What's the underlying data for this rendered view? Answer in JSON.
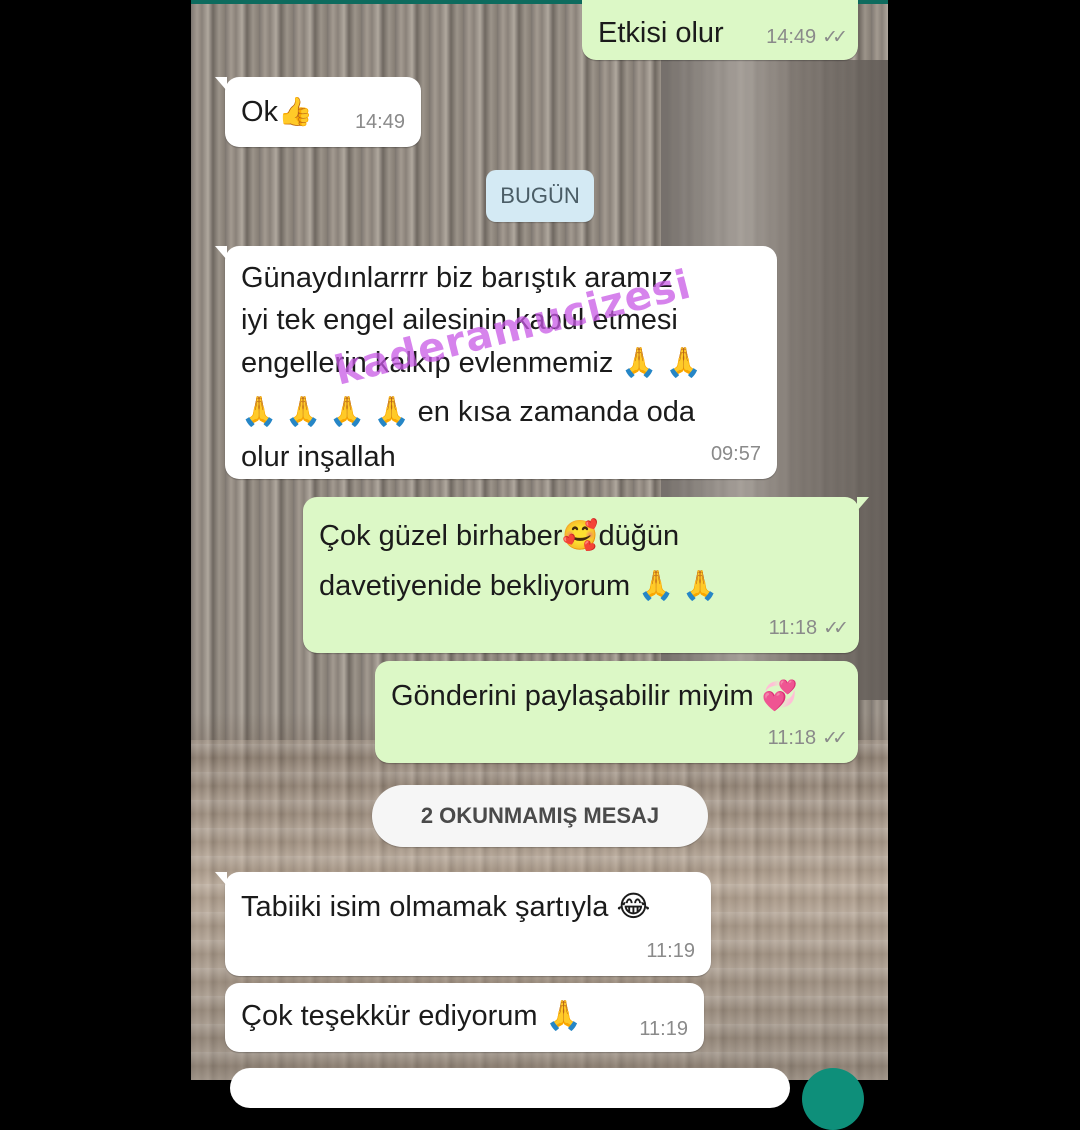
{
  "colors": {
    "incoming": "#ffffff",
    "outgoing": "#dcf8c6",
    "date_pill": "#d4eaf4",
    "accent": "#0e8f7a"
  },
  "messages": [
    {
      "direction": "out",
      "text": "Etkisi olur",
      "time": "14:49",
      "status_icon": "double-check-icon"
    },
    {
      "direction": "in",
      "text": "Ok",
      "emoji": "👍",
      "time": "14:49"
    },
    {
      "direction": "in",
      "lines": [
        "Günaydınlarrrr biz barıştık aramız",
        "iyi tek engel ailesinin kabul etmesi",
        "engellerin kalkıp evlenmemiz 🙏 🙏",
        "🙏 🙏 🙏 🙏 en kısa zamanda oda",
        "olur inşallah"
      ],
      "time": "09:57"
    },
    {
      "direction": "out",
      "lines": [
        "Çok güzel birhaber🥰düğün",
        "davetiyenide bekliyorum 🙏 🙏"
      ],
      "time": "11:18",
      "status_icon": "double-check-icon"
    },
    {
      "direction": "out",
      "text": "Gönderini paylaşabilir miyim 💞",
      "time": "11:18",
      "status_icon": "double-check-icon"
    },
    {
      "direction": "in",
      "text": "Tabiiki isim olmamak şartıyla 😂",
      "time": "11:19"
    },
    {
      "direction": "in",
      "text": "Çok teşekkür ediyorum 🙏",
      "time": "11:19"
    }
  ],
  "date_divider": "BUGÜN",
  "unread_divider": "2 OKUNMAMIŞ MESAJ",
  "ticks": "✓✓",
  "watermark": "kaderamucizesi"
}
